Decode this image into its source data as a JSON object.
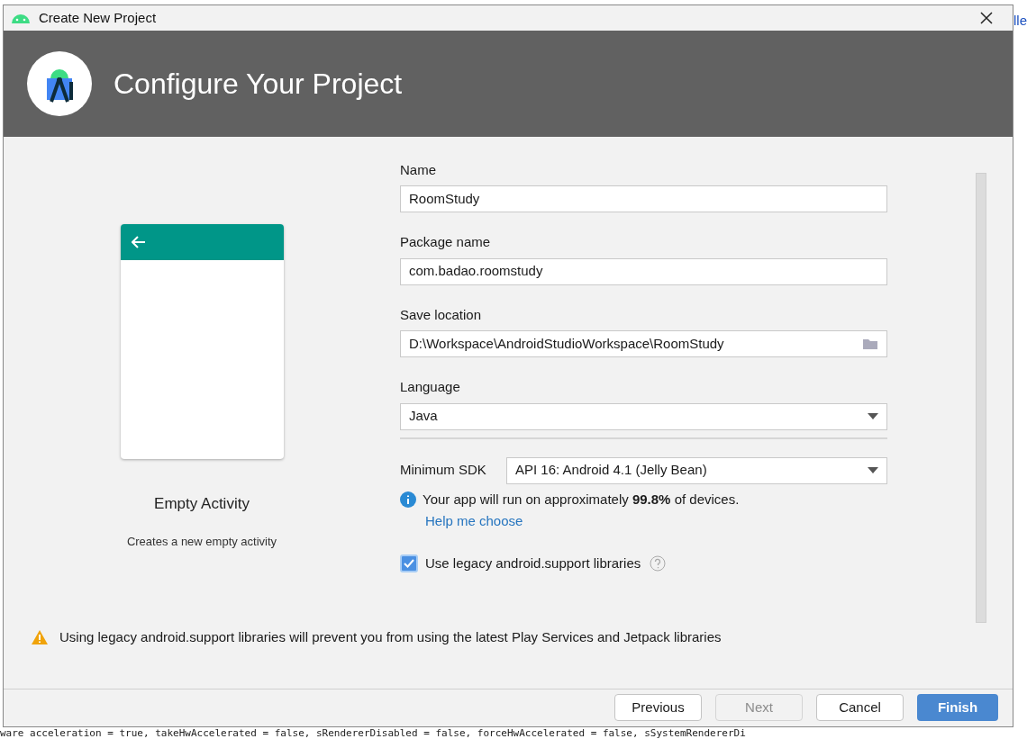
{
  "window": {
    "title": "Create New Project"
  },
  "header": {
    "title": "Configure Your Project"
  },
  "template": {
    "name": "Empty Activity",
    "description": "Creates a new empty activity"
  },
  "form": {
    "name": {
      "label": "Name",
      "value": "RoomStudy"
    },
    "package": {
      "label": "Package name",
      "value": "com.badao.roomstudy"
    },
    "location": {
      "label": "Save location",
      "value": "D:\\Workspace\\AndroidStudioWorkspace\\RoomStudy"
    },
    "language": {
      "label": "Language",
      "value": "Java"
    },
    "min_sdk": {
      "label": "Minimum SDK",
      "value": "API 16: Android 4.1 (Jelly Bean)"
    },
    "info": "Your app will run on approximately **99.8%** of devices.",
    "help_link": "Help me choose",
    "legacy": {
      "label": "Use legacy android.support libraries",
      "checked": true
    }
  },
  "warning": "Using legacy android.support libraries will prevent you from using the latest Play Services and Jetpack libraries",
  "buttons": [
    {
      "label": "Previous",
      "kind": "normal",
      "disabled": false
    },
    {
      "label": "Next",
      "kind": "normal",
      "disabled": true
    },
    {
      "label": "Cancel",
      "kind": "normal",
      "disabled": false
    },
    {
      "label": "Finish",
      "kind": "primary",
      "disabled": false
    }
  ],
  "background": {
    "link_fragment": "lle",
    "log_line": "ware acceleration = true, takeHwAccelerated = false, sRendererDisabled = false, forceHwAccelerated = false, sSystemRendererDi"
  }
}
